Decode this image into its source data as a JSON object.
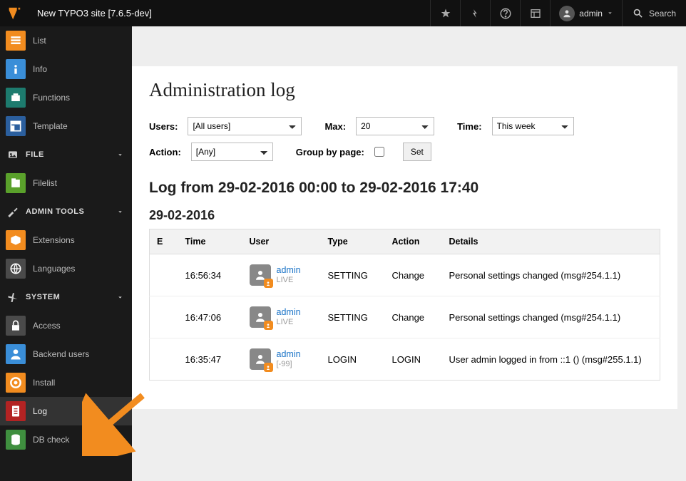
{
  "topbar": {
    "site_title": "New TYPO3 site [7.6.5-dev]",
    "user_label": "admin",
    "search_label": "Search"
  },
  "sidebar": {
    "items_top": [
      {
        "label": "List",
        "color": "bg-orange"
      },
      {
        "label": "Info",
        "color": "bg-blue"
      },
      {
        "label": "Functions",
        "color": "bg-teal"
      },
      {
        "label": "Template",
        "color": "bg-dblue"
      }
    ],
    "group_file": "FILE",
    "items_file": [
      {
        "label": "Filelist",
        "color": "bg-green"
      }
    ],
    "group_admin": "ADMIN TOOLS",
    "items_admin": [
      {
        "label": "Extensions",
        "color": "bg-orange"
      },
      {
        "label": "Languages",
        "color": "bg-gray"
      }
    ],
    "group_system": "SYSTEM",
    "items_system": [
      {
        "label": "Access",
        "color": "bg-gray"
      },
      {
        "label": "Backend users",
        "color": "bg-blue"
      },
      {
        "label": "Install",
        "color": "bg-orange"
      },
      {
        "label": "Log",
        "color": "bg-dred",
        "active": true
      },
      {
        "label": "DB check",
        "color": "bg-mgreen"
      }
    ]
  },
  "page": {
    "title": "Administration log",
    "filters": {
      "users_label": "Users:",
      "users_value": "[All users]",
      "max_label": "Max:",
      "max_value": "20",
      "time_label": "Time:",
      "time_value": "This week",
      "action_label": "Action:",
      "action_value": "[Any]",
      "group_label": "Group by page:",
      "set_button": "Set"
    },
    "range_heading": "Log from 29-02-2016 00:00 to 29-02-2016 17:40",
    "date_heading": "29-02-2016",
    "columns": {
      "e": "E",
      "time": "Time",
      "user": "User",
      "type": "Type",
      "action": "Action",
      "details": "Details"
    },
    "rows": [
      {
        "time": "16:56:34",
        "user": "admin",
        "ws": "LIVE",
        "type": "SETTING",
        "action": "Change",
        "details": "Personal settings changed (msg#254.1.1)"
      },
      {
        "time": "16:47:06",
        "user": "admin",
        "ws": "LIVE",
        "type": "SETTING",
        "action": "Change",
        "details": "Personal settings changed (msg#254.1.1)"
      },
      {
        "time": "16:35:47",
        "user": "admin",
        "ws": "[-99]",
        "type": "LOGIN",
        "action": "LOGIN",
        "details": "User admin logged in from ::1 () (msg#255.1.1)"
      }
    ]
  }
}
